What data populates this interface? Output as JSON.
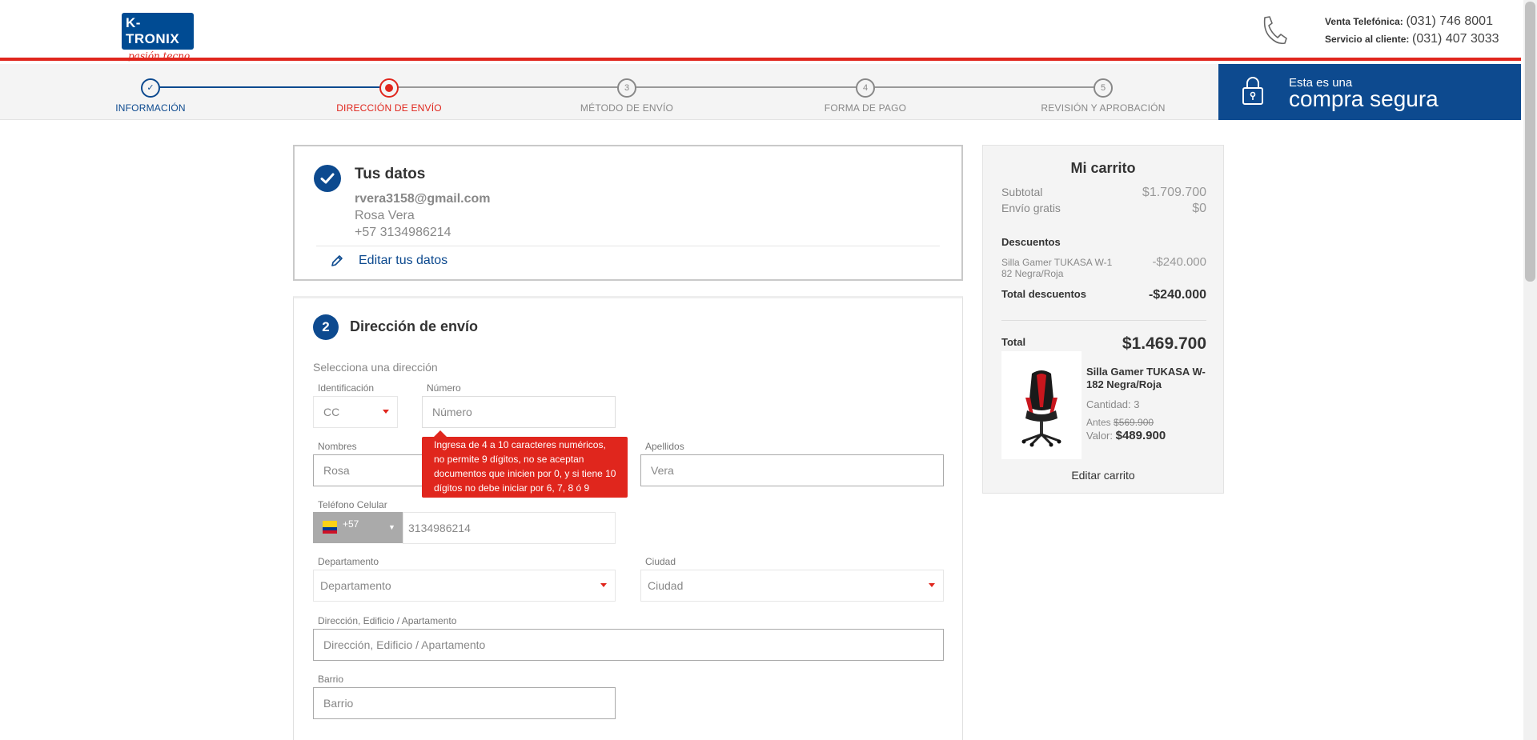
{
  "header": {
    "logo_text": "K-TRONIX",
    "logo_tagline": "pasión tecno",
    "sales_label": "Venta Telefónica:",
    "sales_phone": "(031) 746 8001",
    "support_label": "Servicio al cliente:",
    "support_phone": "(031) 407 3033"
  },
  "steps": [
    {
      "num": "✓",
      "label": "INFORMACIÓN",
      "state": "done"
    },
    {
      "num": "",
      "label": "DIRECCIÓN DE ENVÍO",
      "state": "active"
    },
    {
      "num": "3",
      "label": "MÉTODO DE ENVÍO",
      "state": "todo"
    },
    {
      "num": "4",
      "label": "FORMA DE PAGO",
      "state": "todo"
    },
    {
      "num": "5",
      "label": "REVISIÓN Y APROBACIÓN",
      "state": "todo"
    }
  ],
  "secure": {
    "small": "Esta es una",
    "big": "compra segura"
  },
  "your_data": {
    "title": "Tus datos",
    "email": "rvera3158@gmail.com",
    "name": "Rosa  Vera",
    "phone": "+57 3134986214",
    "edit_label": "Editar tus datos"
  },
  "shipping": {
    "step_number": "2",
    "title": "Dirección de envío",
    "subtitle": "Selecciona una dirección",
    "id_label": "Identificación",
    "id_value": "CC",
    "number_label": "Número",
    "number_placeholder": "Número",
    "tooltip": "Ingresa de 4 a 10 caracteres numéricos, no permite 9 dígitos, no se aceptan documentos que inicien por 0, y si tiene 10 dígitos no debe iniciar por 6, 7, 8 ó 9",
    "names_label": "Nombres",
    "names_value": "Rosa",
    "surnames_label": "Apellidos",
    "surnames_value": "Vera",
    "mobile_label": "Teléfono Celular",
    "country_code": "+57",
    "mobile_value": "3134986214",
    "department_label": "Departamento",
    "department_value": "Departamento",
    "city_label": "Ciudad",
    "city_value": "Ciudad",
    "address_label": "Dirección, Edificio / Apartamento",
    "address_placeholder": "Dirección, Edificio / Apartamento",
    "neighborhood_label": "Barrio",
    "neighborhood_placeholder": "Barrio"
  },
  "cart": {
    "title": "Mi carrito",
    "subtotal_label": "Subtotal",
    "subtotal_value": "$1.709.700",
    "shipping_label": "Envío gratis",
    "shipping_value": "$0",
    "discounts_title": "Descuentos",
    "discount_item": "Silla Gamer TUKASA W-1 82 Negra/Roja",
    "discount_item_value": "-$240.000",
    "total_discounts_label": "Total descuentos",
    "total_discounts_value": "-$240.000",
    "total_label": "Total",
    "total_value": "$1.469.700",
    "product_name": "Silla Gamer TUKASA W-182 Negra/Roja",
    "quantity": "Cantidad: 3",
    "before_label": "Antes",
    "before_price": "$569.900",
    "value_label": "Valor:",
    "value_price": "$489.900",
    "edit_cart": "Editar carrito"
  },
  "colors": {
    "brand_blue": "#0d4a8f",
    "brand_red": "#e0261d"
  }
}
